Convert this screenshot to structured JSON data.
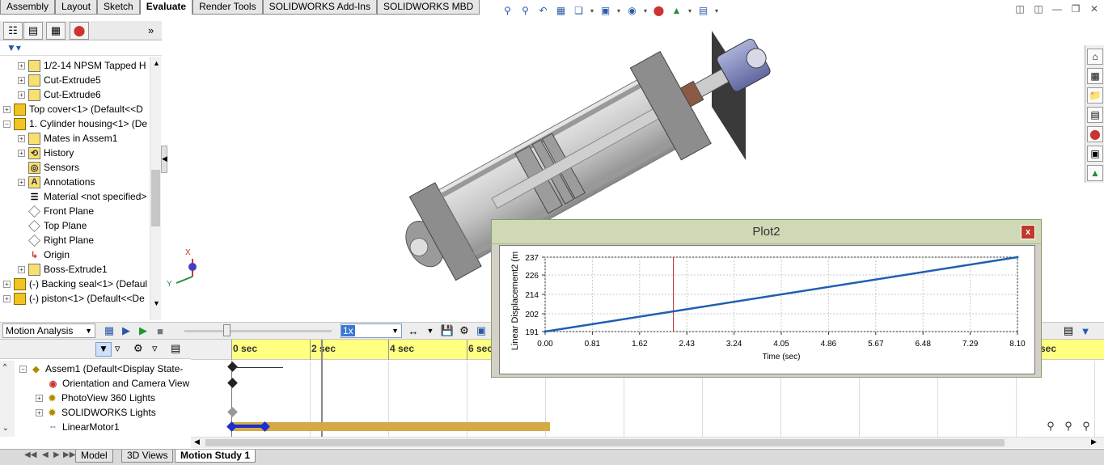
{
  "ribbon": {
    "tabs": [
      "Assembly",
      "Layout",
      "Sketch",
      "Evaluate",
      "Render Tools",
      "SOLIDWORKS Add-Ins",
      "SOLIDWORKS MBD"
    ],
    "active_tab": "Evaluate"
  },
  "feature_tree": {
    "items": [
      {
        "label": "1/2-14 NPSM Tapped H",
        "icon": "hole-feature-icon"
      },
      {
        "label": "Cut-Extrude5",
        "icon": "cut-extrude-icon"
      },
      {
        "label": "Cut-Extrude6",
        "icon": "cut-extrude-icon"
      },
      {
        "label": "Top cover<1> (Default<<D",
        "icon": "part-icon"
      },
      {
        "label": "1. Cylinder housing<1> (De",
        "icon": "part-icon"
      },
      {
        "label": "Mates in Assem1",
        "icon": "mates-icon"
      },
      {
        "label": "History",
        "icon": "history-icon"
      },
      {
        "label": "Sensors",
        "icon": "sensors-icon"
      },
      {
        "label": "Annotations",
        "icon": "annotations-icon"
      },
      {
        "label": "Material <not specified>",
        "icon": "material-icon"
      },
      {
        "label": "Front Plane",
        "icon": "plane-icon"
      },
      {
        "label": "Top Plane",
        "icon": "plane-icon"
      },
      {
        "label": "Right Plane",
        "icon": "plane-icon"
      },
      {
        "label": "Origin",
        "icon": "origin-icon"
      },
      {
        "label": "Boss-Extrude1",
        "icon": "boss-extrude-icon"
      },
      {
        "label": "(-) Backing seal<1> (Defaul",
        "icon": "part-icon"
      },
      {
        "label": "(-) piston<1> (Default<<De",
        "icon": "part-icon"
      }
    ]
  },
  "motion_manager": {
    "study_type": "Motion Analysis",
    "speed": "1x",
    "tree": [
      {
        "label": "Assem1  (Default<Display State-",
        "icon": "assembly-icon"
      },
      {
        "label": "Orientation and Camera View",
        "icon": "camera-view-icon"
      },
      {
        "label": "PhotoView 360 Lights",
        "icon": "lights-icon"
      },
      {
        "label": "SOLIDWORKS Lights",
        "icon": "lights-icon"
      },
      {
        "label": "LinearMotor1",
        "icon": "linear-motor-icon"
      }
    ],
    "timeline_labels": [
      "0 sec",
      "2 sec",
      "4 sec",
      "6 sec",
      "sec"
    ]
  },
  "bottom_tabs": [
    "Model",
    "3D Views",
    "Motion Study 1"
  ],
  "bottom_active": "Motion Study 1",
  "triad": {
    "x": "X",
    "y": "Y"
  },
  "colors": {
    "plot_line": "#1f5fb0",
    "cursor": "#c02020",
    "timeline_bg": "#ffff80",
    "motor_bar": "#d4aa48",
    "motor_key": "#1a2fcc"
  },
  "plot": {
    "title": "Plot2",
    "close_label": "x",
    "chart_data": {
      "type": "line",
      "title": "Plot2",
      "xlabel": "Time (sec)",
      "ylabel": "Linear Displacement2 (m",
      "x_ticks": [
        "0.00",
        "0.81",
        "1.62",
        "2.43",
        "3.24",
        "4.05",
        "4.86",
        "5.67",
        "6.48",
        "7.29",
        "8.10"
      ],
      "y_ticks": [
        "191",
        "202",
        "214",
        "226",
        "237"
      ],
      "xlim": [
        0,
        8.1
      ],
      "ylim": [
        191,
        237
      ],
      "grid": true,
      "cursor_x": 2.2,
      "series": [
        {
          "x": [
            0,
            8.1
          ],
          "y": [
            191,
            237
          ]
        }
      ]
    }
  }
}
